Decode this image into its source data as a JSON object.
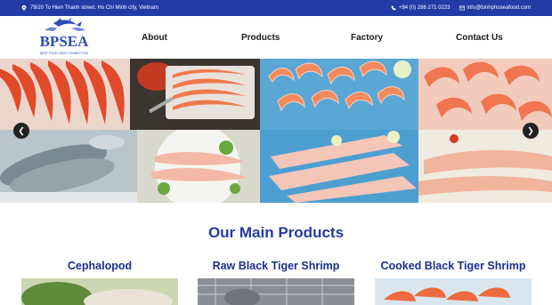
{
  "topbar": {
    "address": "79/20 To Hien Thanh street, Ho Chi Minh city, Vietnam",
    "phone": "+84 (0) 286 271 0223",
    "email": "info@binhphuseafood.com"
  },
  "logo": {
    "brand": "BPSEA",
    "tagline": "BEST FOOD, BEST CONNECTION"
  },
  "nav": {
    "items": [
      {
        "label": "About"
      },
      {
        "label": "Products"
      },
      {
        "label": "Factory"
      },
      {
        "label": "Contact Us"
      }
    ]
  },
  "carousel": {
    "prev_icon": "chevron-left-icon",
    "next_icon": "chevron-right-icon"
  },
  "products": {
    "heading": "Our Main Products",
    "items": [
      {
        "title": "Cephalopod"
      },
      {
        "title": "Raw Black Tiger Shrimp"
      },
      {
        "title": "Cooked Black Tiger Shrimp"
      }
    ]
  },
  "colors": {
    "brand_blue": "#233aa7",
    "heading_blue": "#1a2f8f"
  }
}
